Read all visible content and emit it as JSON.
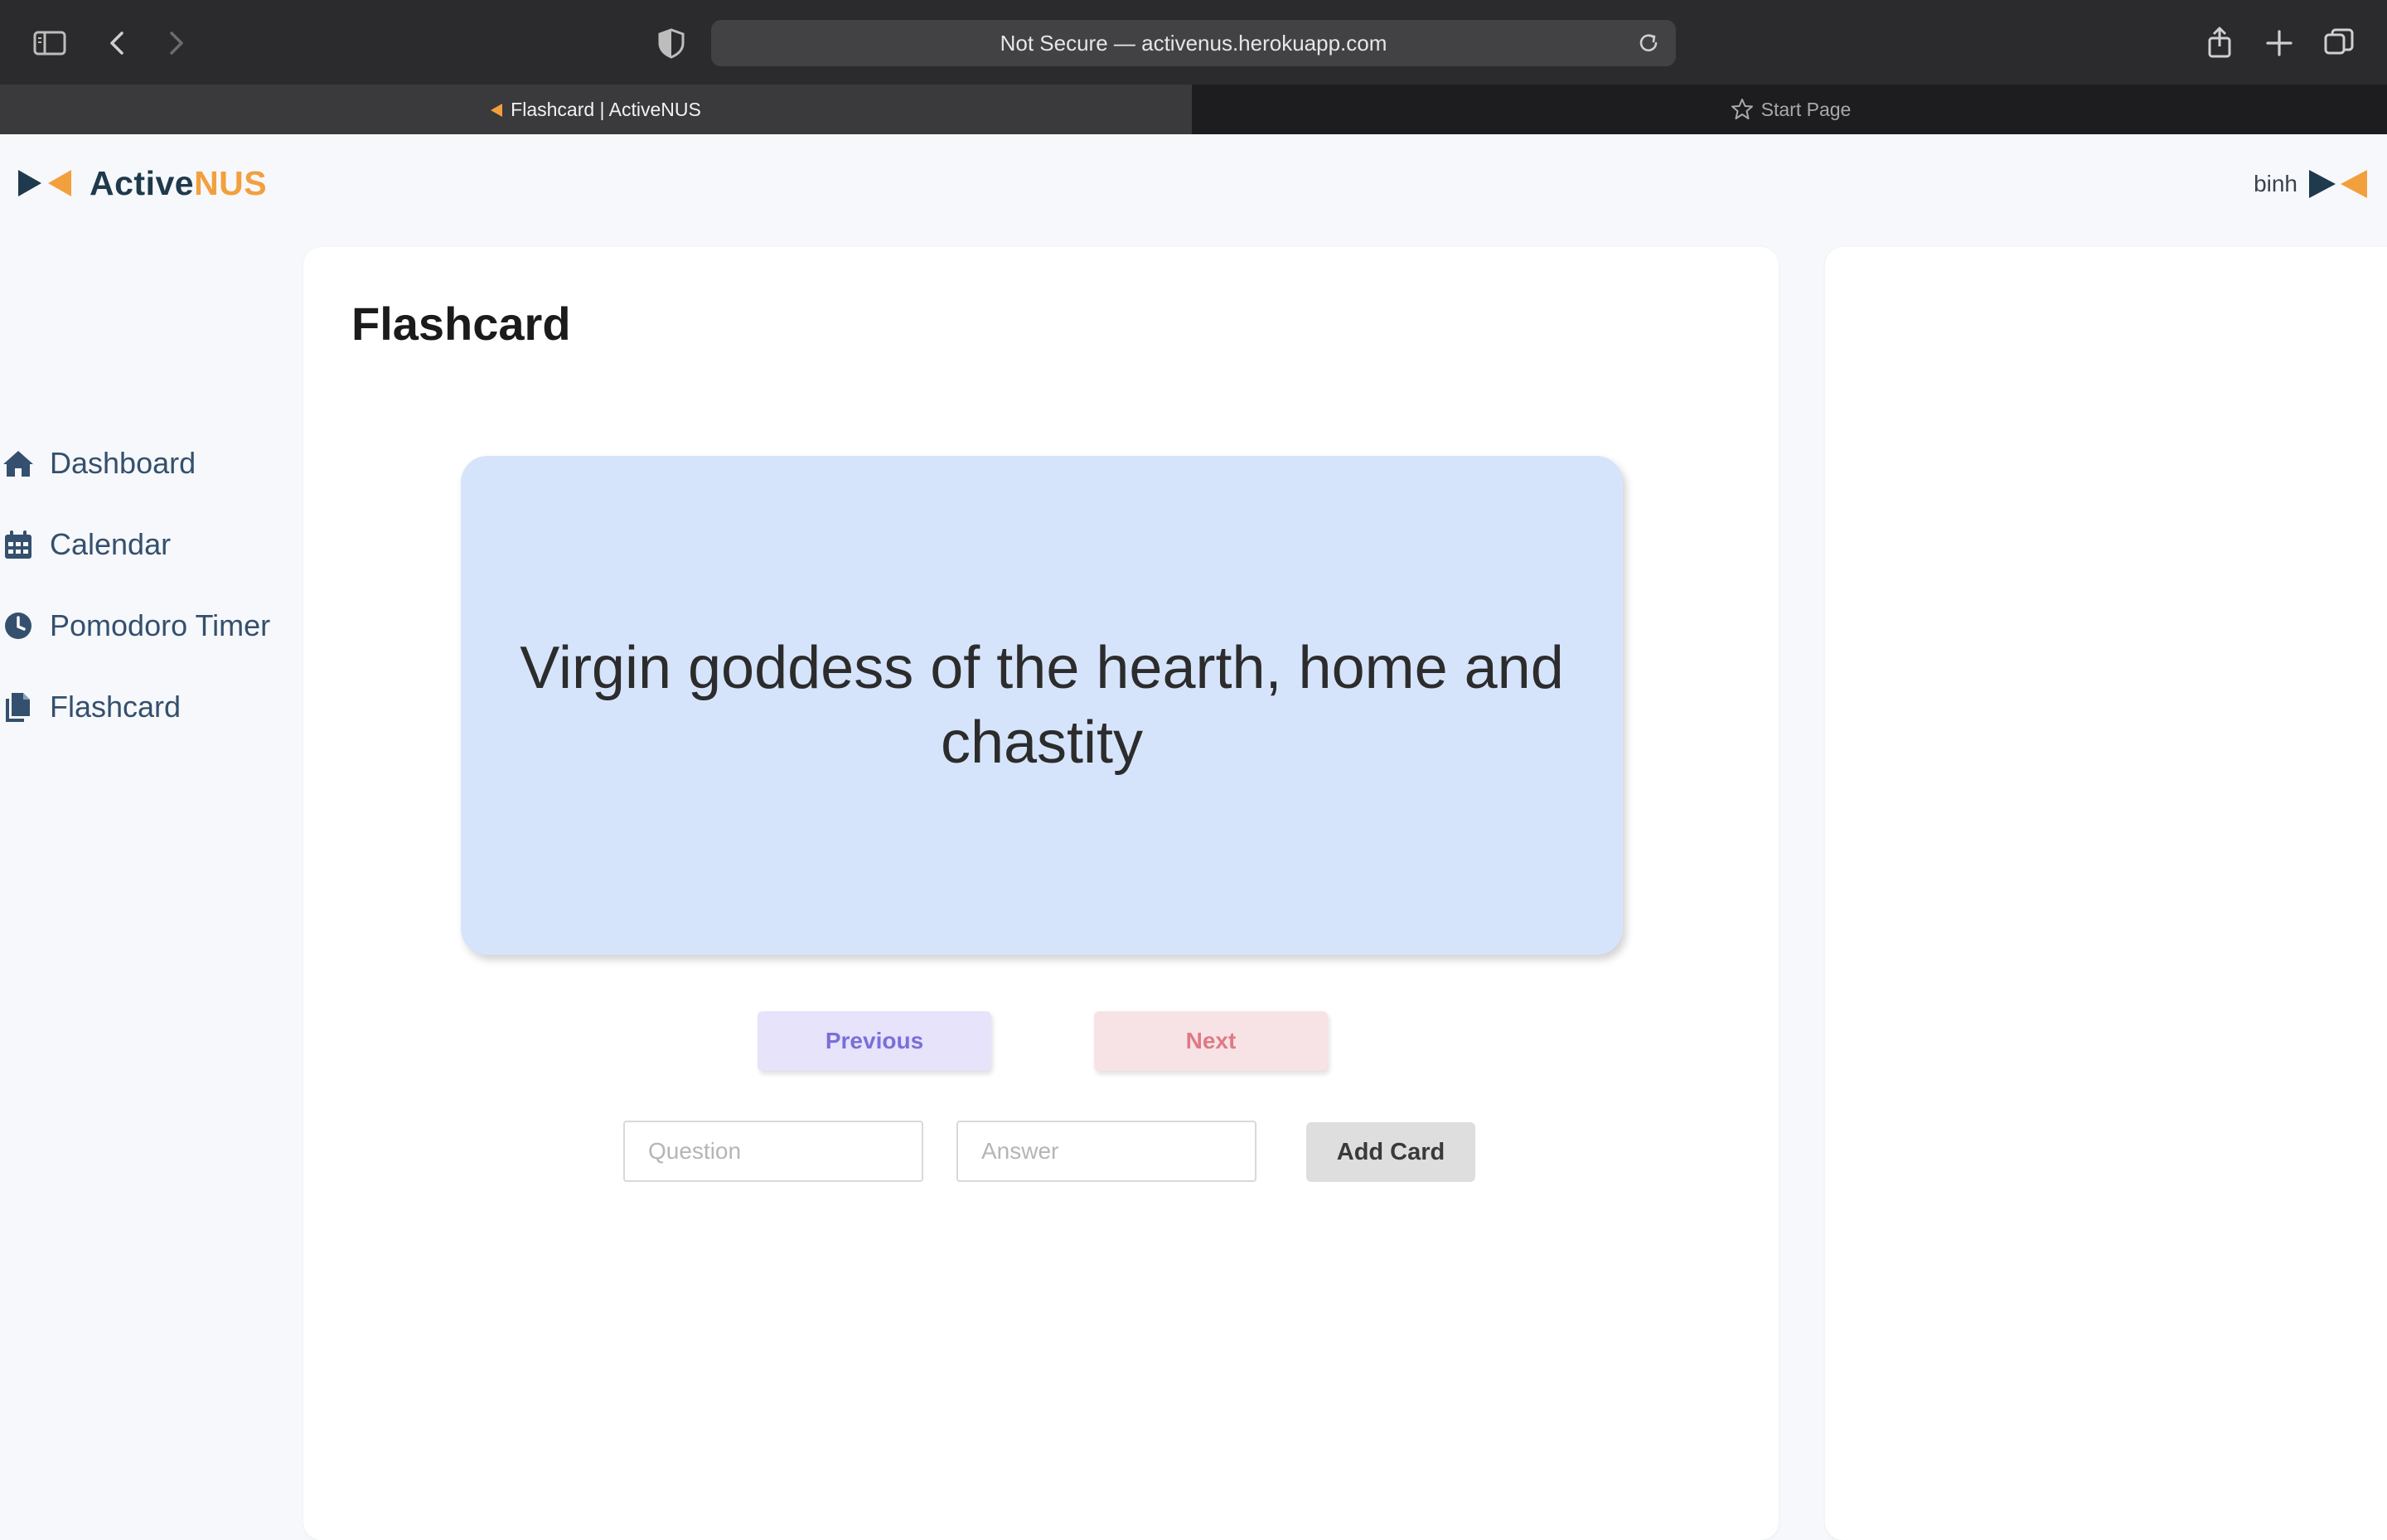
{
  "browser": {
    "address_text": "Not Secure — activenus.herokuapp.com",
    "tabs": [
      {
        "label": "Flashcard | ActiveNUS",
        "active": true
      },
      {
        "label": "Start Page",
        "active": false
      }
    ]
  },
  "brand": {
    "name_part1": "Active",
    "name_part2": "NUS",
    "color_dark": "#1e3a4c",
    "color_accent": "#f2a03d"
  },
  "user": {
    "name": "binh"
  },
  "sidebar": {
    "items": [
      {
        "label": "Dashboard",
        "icon": "home-icon"
      },
      {
        "label": "Calendar",
        "icon": "calendar-icon"
      },
      {
        "label": "Pomodoro Timer",
        "icon": "clock-icon"
      },
      {
        "label": "Flashcard",
        "icon": "copy-icon"
      }
    ]
  },
  "main": {
    "title": "Flashcard",
    "card_text": "Virgin goddess of the hearth, home and chastity",
    "previous_label": "Previous",
    "next_label": "Next",
    "question_placeholder": "Question",
    "answer_placeholder": "Answer",
    "add_label": "Add Card"
  }
}
